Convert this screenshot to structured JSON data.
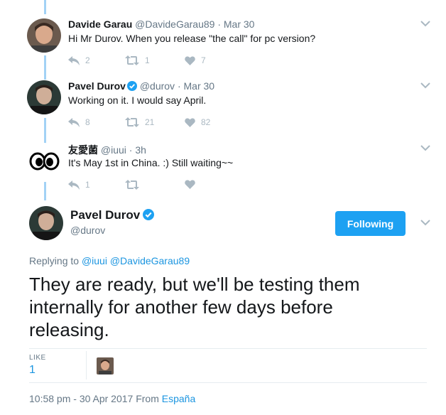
{
  "colors": {
    "accent": "#1da1f2",
    "link": "#1b95e0",
    "muted": "#657786",
    "thread": "#a2d2f5"
  },
  "replies": [
    {
      "name": "Davide Garau",
      "handle": "@DavideGarau89",
      "dot": "·",
      "time": "Mar 30",
      "text": "Hi Mr Durov. When you release \"the call\" for pc version?",
      "replies": "2",
      "retweets": "1",
      "likes": "7",
      "verified": false
    },
    {
      "name": "Pavel Durov",
      "handle": "@durov",
      "dot": "·",
      "time": "Mar 30",
      "text": "Working on it. I would say April.",
      "replies": "8",
      "retweets": "21",
      "likes": "82",
      "verified": true
    },
    {
      "name": "友愛菌",
      "handle": "@iuui",
      "dot": "·",
      "time": "3h",
      "text": "It's May 1st in China. :) Still waiting~~",
      "replies": "1",
      "retweets": "",
      "likes": "",
      "verified": false
    }
  ],
  "main": {
    "name": "Pavel Durov",
    "handle": "@durov",
    "follow_label": "Following",
    "replying_to_label": "Replying to",
    "mention_1": "@iuui",
    "mention_2": "@DavideGarau89",
    "text": "They are ready, but we'll be testing them internally for another few days before releasing.",
    "like_label": "LIKE",
    "like_count": "1",
    "timestamp": "10:58 pm - 30 Apr 2017 From",
    "location": "España"
  },
  "icons": [
    "reply-icon",
    "retweet-icon",
    "heart-icon",
    "chevron-down-icon",
    "verified-badge-icon"
  ]
}
